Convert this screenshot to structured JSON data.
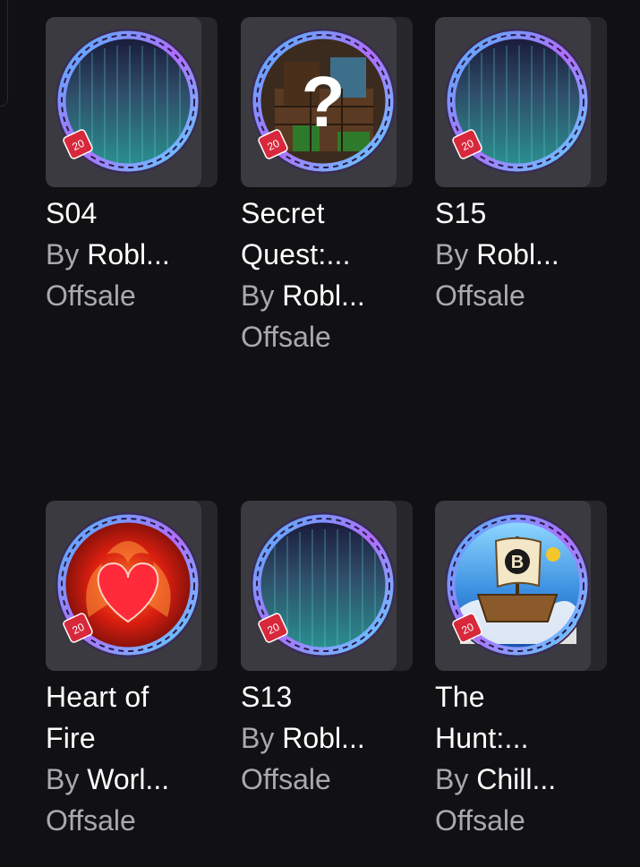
{
  "items": [
    {
      "title_lines": [
        "S04"
      ],
      "by": "By",
      "creator": "Robl...",
      "price": "Offsale",
      "art": "aurora"
    },
    {
      "title_lines": [
        "Secret",
        "Quest:..."
      ],
      "by": "By",
      "creator": "Robl...",
      "price": "Offsale",
      "art": "secret"
    },
    {
      "title_lines": [
        "S15"
      ],
      "by": "By",
      "creator": "Robl...",
      "price": "Offsale",
      "art": "aurora"
    },
    {
      "title_lines": [
        "Heart of",
        "Fire"
      ],
      "by": "By",
      "creator": "Worl...",
      "price": "Offsale",
      "art": "heart"
    },
    {
      "title_lines": [
        "S13"
      ],
      "by": "By",
      "creator": "Robl...",
      "price": "Offsale",
      "art": "aurora"
    },
    {
      "title_lines": [
        "The",
        "Hunt:..."
      ],
      "by": "By",
      "creator": "Chill...",
      "price": "Offsale",
      "art": "ship"
    }
  ],
  "badge_level": "20",
  "secret_glyph": "?",
  "ship_letter": "B",
  "colors": {
    "background": "#111114",
    "tile": "#3a3a40",
    "title_text": "#ffffff",
    "secondary_text": "#a9a9b0",
    "level_tag": "#d8283c",
    "ring_blue": "#4fb8ff",
    "ring_purple": "#b06cff"
  }
}
